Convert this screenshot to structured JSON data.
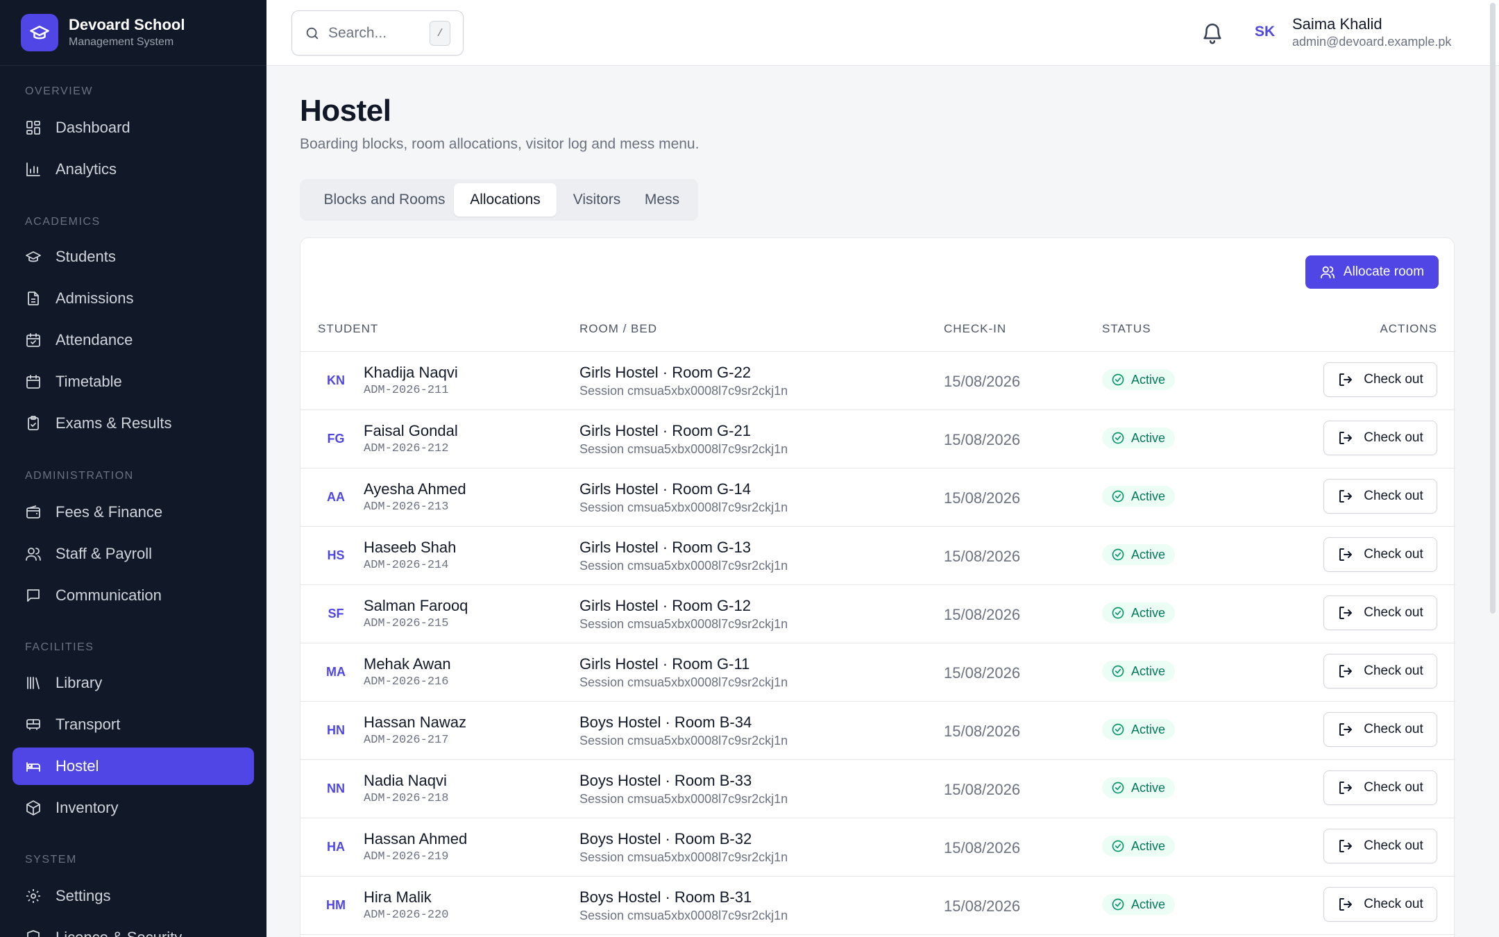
{
  "brand": {
    "name": "Devoard School",
    "subtitle": "Management System"
  },
  "sidebar": {
    "sections": [
      {
        "title": "Overview",
        "items": [
          {
            "label": "Dashboard",
            "icon": "dashboard-icon"
          },
          {
            "label": "Analytics",
            "icon": "analytics-icon"
          }
        ]
      },
      {
        "title": "Academics",
        "items": [
          {
            "label": "Students",
            "icon": "graduation-cap-icon"
          },
          {
            "label": "Admissions",
            "icon": "document-icon"
          },
          {
            "label": "Attendance",
            "icon": "calendar-check-icon"
          },
          {
            "label": "Timetable",
            "icon": "calendar-icon"
          },
          {
            "label": "Exams & Results",
            "icon": "clipboard-icon"
          }
        ]
      },
      {
        "title": "Administration",
        "items": [
          {
            "label": "Fees & Finance",
            "icon": "wallet-icon"
          },
          {
            "label": "Staff & Payroll",
            "icon": "users-icon"
          },
          {
            "label": "Communication",
            "icon": "message-icon"
          }
        ]
      },
      {
        "title": "Facilities",
        "items": [
          {
            "label": "Library",
            "icon": "library-icon"
          },
          {
            "label": "Transport",
            "icon": "bus-icon"
          },
          {
            "label": "Hostel",
            "icon": "bed-icon",
            "active": true
          },
          {
            "label": "Inventory",
            "icon": "package-icon"
          }
        ]
      },
      {
        "title": "System",
        "items": [
          {
            "label": "Settings",
            "icon": "gear-icon"
          },
          {
            "label": "Licence & Security",
            "icon": "shield-icon"
          }
        ]
      }
    ]
  },
  "search": {
    "placeholder": "Search...",
    "shortcut": "/"
  },
  "user": {
    "initials": "SK",
    "name": "Saima Khalid",
    "email": "admin@devoard.example.pk"
  },
  "page": {
    "title": "Hostel",
    "subtitle": "Boarding blocks, room allocations, visitor log and mess menu."
  },
  "tabs": [
    {
      "label": "Blocks and Rooms"
    },
    {
      "label": "Allocations",
      "active": true
    },
    {
      "label": "Visitors"
    },
    {
      "label": "Mess"
    }
  ],
  "actions": {
    "allocate_label": "Allocate room"
  },
  "table": {
    "headers": {
      "student": "Student",
      "room": "Room / Bed",
      "checkin": "Check-in",
      "status": "Status",
      "actions": "Actions"
    },
    "rows": [
      {
        "initials": "KN",
        "name": "Khadija Naqvi",
        "adm": "ADM-2026-211",
        "room": "Girls Hostel · Room G-22",
        "session": "Session cmsua5xbx0008l7c9sr2ckj1n",
        "checkin": "15/08/2026",
        "status": "Active",
        "action": "Check out"
      },
      {
        "initials": "FG",
        "name": "Faisal Gondal",
        "adm": "ADM-2026-212",
        "room": "Girls Hostel · Room G-21",
        "session": "Session cmsua5xbx0008l7c9sr2ckj1n",
        "checkin": "15/08/2026",
        "status": "Active",
        "action": "Check out"
      },
      {
        "initials": "AA",
        "name": "Ayesha Ahmed",
        "adm": "ADM-2026-213",
        "room": "Girls Hostel · Room G-14",
        "session": "Session cmsua5xbx0008l7c9sr2ckj1n",
        "checkin": "15/08/2026",
        "status": "Active",
        "action": "Check out"
      },
      {
        "initials": "HS",
        "name": "Haseeb Shah",
        "adm": "ADM-2026-214",
        "room": "Girls Hostel · Room G-13",
        "session": "Session cmsua5xbx0008l7c9sr2ckj1n",
        "checkin": "15/08/2026",
        "status": "Active",
        "action": "Check out"
      },
      {
        "initials": "SF",
        "name": "Salman Farooq",
        "adm": "ADM-2026-215",
        "room": "Girls Hostel · Room G-12",
        "session": "Session cmsua5xbx0008l7c9sr2ckj1n",
        "checkin": "15/08/2026",
        "status": "Active",
        "action": "Check out"
      },
      {
        "initials": "MA",
        "name": "Mehak Awan",
        "adm": "ADM-2026-216",
        "room": "Girls Hostel · Room G-11",
        "session": "Session cmsua5xbx0008l7c9sr2ckj1n",
        "checkin": "15/08/2026",
        "status": "Active",
        "action": "Check out"
      },
      {
        "initials": "HN",
        "name": "Hassan Nawaz",
        "adm": "ADM-2026-217",
        "room": "Boys Hostel · Room B-34",
        "session": "Session cmsua5xbx0008l7c9sr2ckj1n",
        "checkin": "15/08/2026",
        "status": "Active",
        "action": "Check out"
      },
      {
        "initials": "NN",
        "name": "Nadia Naqvi",
        "adm": "ADM-2026-218",
        "room": "Boys Hostel · Room B-33",
        "session": "Session cmsua5xbx0008l7c9sr2ckj1n",
        "checkin": "15/08/2026",
        "status": "Active",
        "action": "Check out"
      },
      {
        "initials": "HA",
        "name": "Hassan Ahmed",
        "adm": "ADM-2026-219",
        "room": "Boys Hostel · Room B-32",
        "session": "Session cmsua5xbx0008l7c9sr2ckj1n",
        "checkin": "15/08/2026",
        "status": "Active",
        "action": "Check out"
      },
      {
        "initials": "HM",
        "name": "Hira Malik",
        "adm": "ADM-2026-220",
        "room": "Boys Hostel · Room B-31",
        "session": "Session cmsua5xbx0008l7c9sr2ckj1n",
        "checkin": "15/08/2026",
        "status": "Active",
        "action": "Check out"
      }
    ]
  },
  "colors": {
    "accent": "#4f46e5",
    "sidebar_bg": "#111827",
    "success": "#047857",
    "success_bg": "#ecfdf5"
  }
}
